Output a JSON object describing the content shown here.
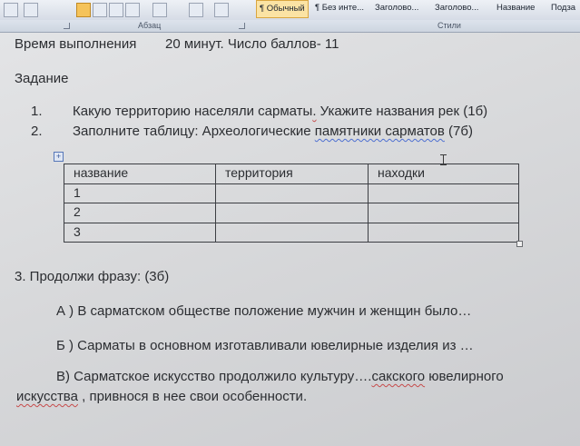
{
  "ribbon": {
    "style_gallery": [
      "¶ Обычный",
      "¶ Без инте...",
      "Заголово...",
      "Заголово...",
      "Название",
      "Подза"
    ],
    "groups": {
      "paragraph": "Абзац",
      "styles": "Стили"
    }
  },
  "document": {
    "header_time": "Время выполнения",
    "header_rest": "20 минут. Число баллов- 11",
    "task_heading": "Задание",
    "items": [
      {
        "num": "1.",
        "text_a": "Какую территорию населяли сарматы",
        "text_b": " Укажите названия рек (1б)",
        "sep": "."
      },
      {
        "num": "2.",
        "text_a": "Заполните таблицу: Археологические ",
        "text_b": "памятники  сарматов",
        "text_c": " (7б)"
      }
    ],
    "table": {
      "headers": [
        "название",
        "территория",
        "находки"
      ],
      "rows": [
        [
          "1",
          "",
          ""
        ],
        [
          "2",
          "",
          ""
        ],
        [
          "3",
          "",
          ""
        ]
      ]
    },
    "q3_title": "3. Продолжи фразу: (3б)",
    "q3_a": "А ) В сарматском обществе положение мужчин и женщин было…",
    "q3_b": "Б ) Сарматы в основном изготавливали ювелирные изделия из …",
    "q3_c_line1_a": "В)  Сарматское искусство продолжило культуру….",
    "q3_c_line1_b": "сакского",
    "q3_c_line1_c": " ювелирного",
    "q3_c_line2_a": "искусства",
    "q3_c_line2_b": " , привнося в нее свои особенности."
  }
}
